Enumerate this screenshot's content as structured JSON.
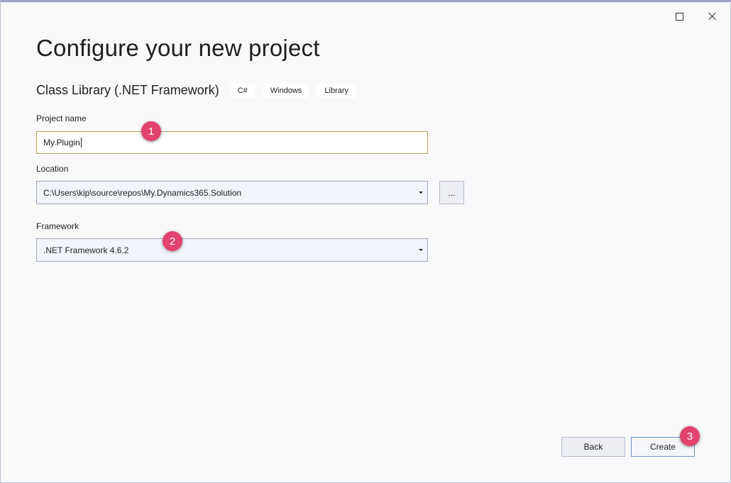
{
  "header": {
    "title": "Configure your new project"
  },
  "template": {
    "name": "Class Library (.NET Framework)",
    "tags": [
      "C#",
      "Windows",
      "Library"
    ]
  },
  "form": {
    "project_name": {
      "label": "Project name",
      "value": "My.Plugin"
    },
    "location": {
      "label": "Location",
      "value": "C:\\Users\\kip\\source\\repos\\My.Dynamics365.Solution",
      "browse_label": "..."
    },
    "framework": {
      "label": "Framework",
      "value": ".NET Framework 4.6.2"
    }
  },
  "footer": {
    "back_label": "Back",
    "create_label": "Create"
  },
  "annotations": [
    "1",
    "2",
    "3"
  ],
  "colors": {
    "accent": "#e2426e",
    "input_focus_border": "#b9a456",
    "primary_button_border": "#6a93c9"
  }
}
